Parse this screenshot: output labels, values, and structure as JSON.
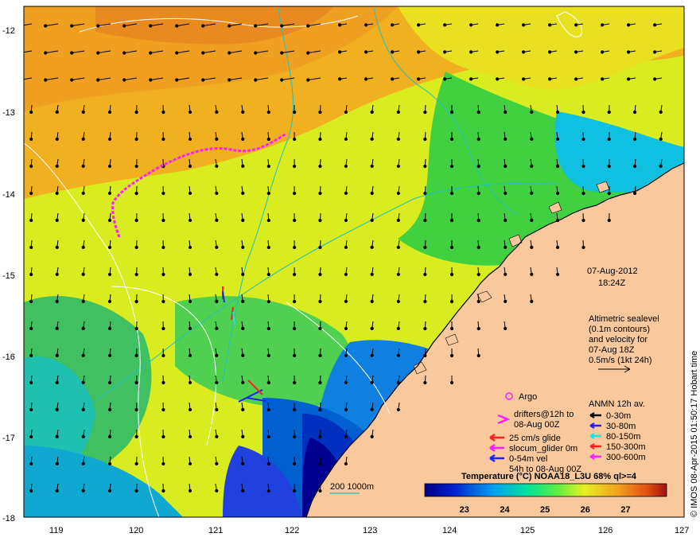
{
  "map": {
    "lat_ticks": [
      "-12",
      "-13",
      "-14",
      "-15",
      "-16",
      "-17",
      "-18"
    ],
    "lon_ticks": [
      "119",
      "120",
      "121",
      "122",
      "123",
      "124",
      "125",
      "126",
      "127"
    ],
    "date": "07-Aug-2012",
    "time": "18:24Z",
    "altimetry_lines": [
      "Altimetric sealevel",
      "(0.1m contours)",
      "and velocity for",
      "07-Aug 18Z",
      "0.5m/s (1kt 24h)"
    ],
    "argo_label": "Argo",
    "drifters_lines": [
      "drifters@12h to",
      "08-Aug 00Z"
    ],
    "glider_legend": [
      {
        "label": "25 cm/s glide",
        "color": "#ff2020"
      },
      {
        "label": "slocum_glider 0m",
        "color": "#ff20ff"
      },
      {
        "label": "0-54m vel",
        "color": "#2020ff"
      }
    ],
    "glider_note": "54h to 08-Aug 00Z",
    "anmn_title": "ANMN 12h av.",
    "anmn_legend": [
      {
        "label": "0-30m",
        "color": "#000000"
      },
      {
        "label": "30-80m",
        "color": "#2020ff"
      },
      {
        "label": "80-150m",
        "color": "#20e0e0"
      },
      {
        "label": "150-300m",
        "color": "#ff2020"
      },
      {
        "label": "300-600m",
        "color": "#ff20ff"
      }
    ],
    "isobath_label": "200  1000m",
    "colorbar_title": "Temperature (°C) NOAA18_L3U 68% ql>=4",
    "colorbar_ticks": [
      "23",
      "24",
      "25",
      "26",
      "27"
    ],
    "colorbar_range": [
      22,
      28
    ],
    "credit": "© IMOS 08-Apr-2015 01:50:17 Hobart time",
    "colors": {
      "land": "#f9c89c",
      "warm": "#f0a020",
      "yellow": "#e8f020",
      "green": "#30d040",
      "cyan": "#10c0e0",
      "blue": "#0030d0",
      "navy": "#000080",
      "drifter": "#ff20ff",
      "isobath": "#20c0c0",
      "contour": "#ffffff"
    }
  }
}
